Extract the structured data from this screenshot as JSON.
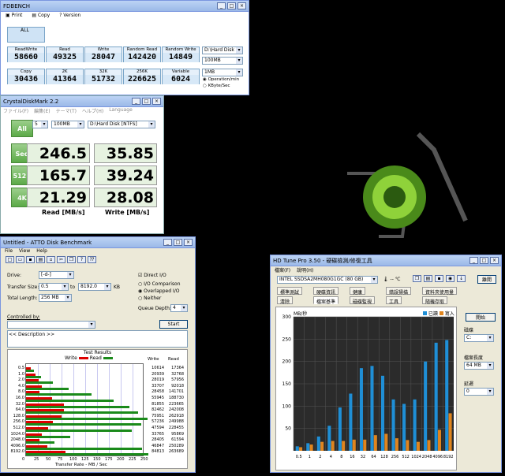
{
  "fd": {
    "title": "FDBENCH",
    "menu": [
      "Print",
      "Copy",
      "Version"
    ],
    "all": "ALL",
    "cells": [
      {
        "t": "ReadWrite",
        "v": "58660"
      },
      {
        "t": "Read",
        "v": "49325"
      },
      {
        "t": "Write",
        "v": "28047"
      },
      {
        "t": "Random Read",
        "v": "142420"
      },
      {
        "t": "Random Write",
        "v": "14849"
      },
      {
        "t": "Copy",
        "v": "30436"
      },
      {
        "t": "2K",
        "v": "41364"
      },
      {
        "t": "32K",
        "v": "51732"
      },
      {
        "t": "256K",
        "v": "226625"
      },
      {
        "t": "Variable",
        "v": "6024"
      }
    ],
    "drive": "D:\\Hard Disk",
    "size": "100MB",
    "block": "1MB",
    "op1": "Operation/min",
    "op2": "KByte/Sec"
  },
  "cdm": {
    "title": "CrystalDiskMark 2.2",
    "menu": [
      "ファイル(F)",
      "編集(E)",
      "テーマ(T)",
      "ヘルプ(H)",
      "Language"
    ],
    "all": "All",
    "count": "5",
    "size": "100MB",
    "drive": "D:\\Hard Disk [NTFS]",
    "rows": [
      {
        "k": "Seq",
        "r": "246.5",
        "w": "35.85"
      },
      {
        "k": "512K",
        "r": "165.7",
        "w": "39.24"
      },
      {
        "k": "4K",
        "r": "21.29",
        "w": "28.08"
      }
    ],
    "rlabel": "Read [MB/s]",
    "wlabel": "Write [MB/s]"
  },
  "atto": {
    "title": "Untitled - ATTO Disk Benchmark",
    "menu": [
      "File",
      "View",
      "Help"
    ],
    "drive_l": "Drive:",
    "drive": "[-d-]",
    "ts_l": "Transfer Size:",
    "ts_from": "0.5",
    "to": "to",
    "ts_to": "8192.0",
    "kb": "KB",
    "tl_l": "Total Length:",
    "tl": "256 MB",
    "direct": "Direct I/O",
    "io1": "I/O Comparison",
    "io2": "Overlapped I/O",
    "io3": "Neither",
    "qd_l": "Queue Depth:",
    "qd": "4",
    "ctl": "Controlled by:",
    "start": "Start",
    "desc": "<< Description >>",
    "results": "Test Results",
    "write": "Write",
    "read": "Read",
    "xlabel": "Transfer Rate - MB / Sec",
    "xticks": [
      "0",
      "25",
      "50",
      "75",
      "100",
      "125",
      "150",
      "175",
      "200",
      "225",
      "250"
    ],
    "rows": [
      [
        "0.5",
        "10614",
        "17364"
      ],
      [
        "1.0",
        "20939",
        "32768"
      ],
      [
        "2.0",
        "28019",
        "57956"
      ],
      [
        "4.0",
        "33707",
        "92018"
      ],
      [
        "8.0",
        "28458",
        "141701"
      ],
      [
        "16.0",
        "55945",
        "188730"
      ],
      [
        "32.0",
        "81855",
        "223665"
      ],
      [
        "64.0",
        "82462",
        "242008"
      ],
      [
        "128.0",
        "75951",
        "262918"
      ],
      [
        "256.0",
        "57236",
        "249988"
      ],
      [
        "512.0",
        "47594",
        "228455"
      ],
      [
        "1024.0",
        "33765",
        "95869"
      ],
      [
        "2048.0",
        "28405",
        "61594"
      ],
      [
        "4096.0",
        "46847",
        "250289"
      ],
      [
        "8192.0",
        "84813",
        "263689"
      ]
    ]
  },
  "hdt": {
    "title": "HD Tune Pro 3.50 - 硬碟檢測/修復工具",
    "menu": [
      "檔案(F)",
      "說明(H)"
    ],
    "disk": "INTEL SSDSA2MH080G1GC (80 GB)",
    "temp": "-- ℃",
    "exit": "離開",
    "tabs1": [
      "標準測試",
      "硬碟資訊",
      "健康",
      "錯誤掃描",
      "資料夾使用量"
    ],
    "tabs2": [
      "清除",
      "檔案基準",
      "磁碟監視",
      "工具",
      "隨機存取"
    ],
    "start": "開始",
    "drive_l": "磁碟",
    "drive": "C:",
    "len_l": "檔案長度",
    "len": "64 MB",
    "delay_l": "延遲",
    "delay": "0",
    "unit": "MB/秒",
    "read": "已讀",
    "write": "寫入",
    "yticks": [
      "300",
      "250",
      "200",
      "150",
      "100",
      "50"
    ],
    "xticks": [
      "0.5",
      "1",
      "2",
      "4",
      "8",
      "16",
      "32",
      "64",
      "128",
      "256",
      "512",
      "1024",
      "2048",
      "4096",
      "8192"
    ],
    "colors": {
      "read": "#1f8fd6",
      "write": "#e0851e"
    }
  },
  "chart_data": {
    "type": "bar",
    "title": "",
    "xlabel": "",
    "ylabel": "MB/秒",
    "ylim": [
      0,
      300
    ],
    "categories": [
      "0.5",
      "1",
      "2",
      "4",
      "8",
      "16",
      "32",
      "64",
      "128",
      "256",
      "512",
      "1024",
      "2048",
      "4096",
      "8192"
    ],
    "series": [
      {
        "name": "已讀",
        "values": [
          10,
          17,
          32,
          56,
          97,
          128,
          185,
          190,
          168,
          115,
          105,
          115,
          200,
          242,
          248
        ]
      },
      {
        "name": "寫入",
        "values": [
          8,
          14,
          20,
          22,
          22,
          25,
          25,
          35,
          38,
          28,
          24,
          20,
          24,
          47,
          84
        ]
      }
    ]
  }
}
